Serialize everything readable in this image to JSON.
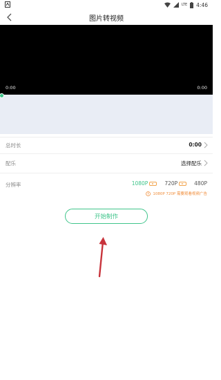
{
  "status_bar": {
    "time": "4:46",
    "icons": [
      "notification-icon",
      "wifi-icon",
      "signal-icon",
      "battery-icon"
    ],
    "signal_label": "LTE"
  },
  "header": {
    "title": "图片转视频",
    "back_icon": "chevron-left-icon"
  },
  "player": {
    "current_time": "0:00",
    "total_time": "0:00"
  },
  "settings": {
    "duration": {
      "label": "总时长",
      "value": "0:00"
    },
    "music": {
      "label": "配乐",
      "value": "选择配乐"
    },
    "resolution": {
      "label": "分辨率",
      "options": [
        "1080P",
        "720P",
        "480P"
      ],
      "selected": "1080P",
      "ad_badges": [
        "1080P",
        "720P"
      ],
      "tip": "1080P 720P 需要观看视频广告"
    }
  },
  "actions": {
    "start_label": "开始制作"
  },
  "colors": {
    "accent": "#3ec48a",
    "warning": "#f08d3a",
    "annotation_arrow": "#c8343c",
    "timeline_bg": "#e9edf5"
  }
}
